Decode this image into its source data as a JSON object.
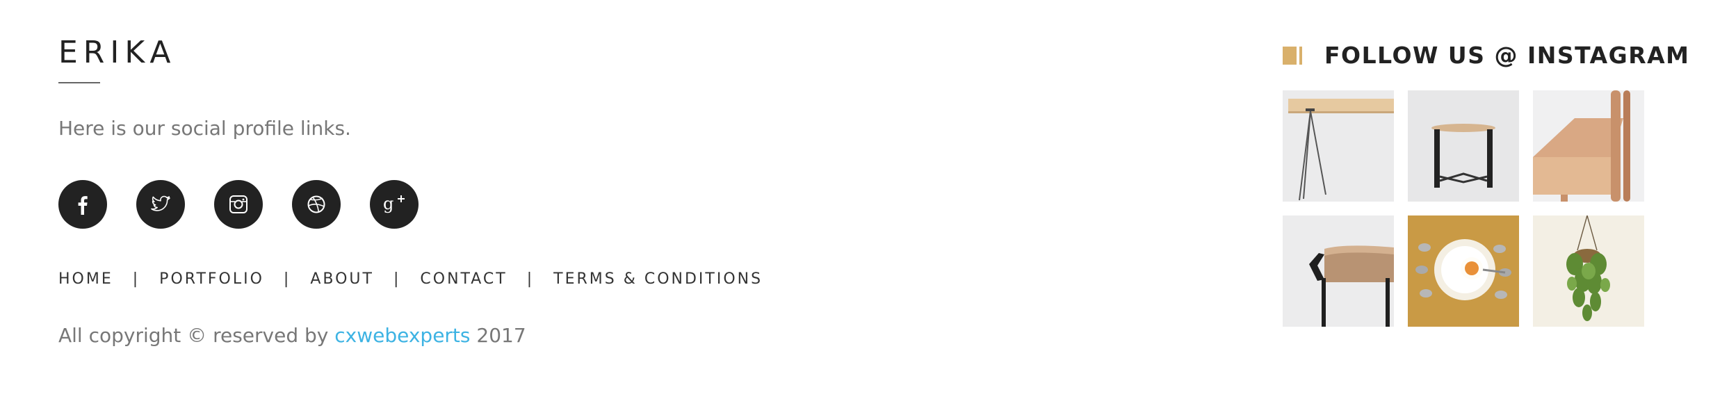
{
  "brand": {
    "name": "ERIKA"
  },
  "tagline": "Here is our social profile links.",
  "social": [
    {
      "name": "facebook",
      "icon": "facebook-icon"
    },
    {
      "name": "twitter",
      "icon": "twitter-icon"
    },
    {
      "name": "instagram",
      "icon": "instagram-icon"
    },
    {
      "name": "dribbble",
      "icon": "dribbble-icon"
    },
    {
      "name": "google-plus",
      "icon": "google-plus-icon"
    }
  ],
  "nav": {
    "items": [
      "HOME",
      "PORTFOLIO",
      "ABOUT",
      "CONTACT",
      "TERMS & CONDITIONS"
    ],
    "separator": "|"
  },
  "copyright": {
    "prefix": "All copyright © reserved by ",
    "link": "cxwebexperts",
    "suffix": " 2017"
  },
  "instagram": {
    "title": "FOLLOW US @ INSTAGRAM",
    "accent": "#d9b06b",
    "tiles": [
      {
        "subject": "wooden table with metal legs"
      },
      {
        "subject": "small black side table"
      },
      {
        "subject": "wooden chair"
      },
      {
        "subject": "round wooden table edge"
      },
      {
        "subject": "egg on plate with spoons"
      },
      {
        "subject": "hanging plant"
      }
    ]
  },
  "colors": {
    "link": "#3db3e3",
    "icon_bg": "#222222",
    "text": "#777777"
  }
}
